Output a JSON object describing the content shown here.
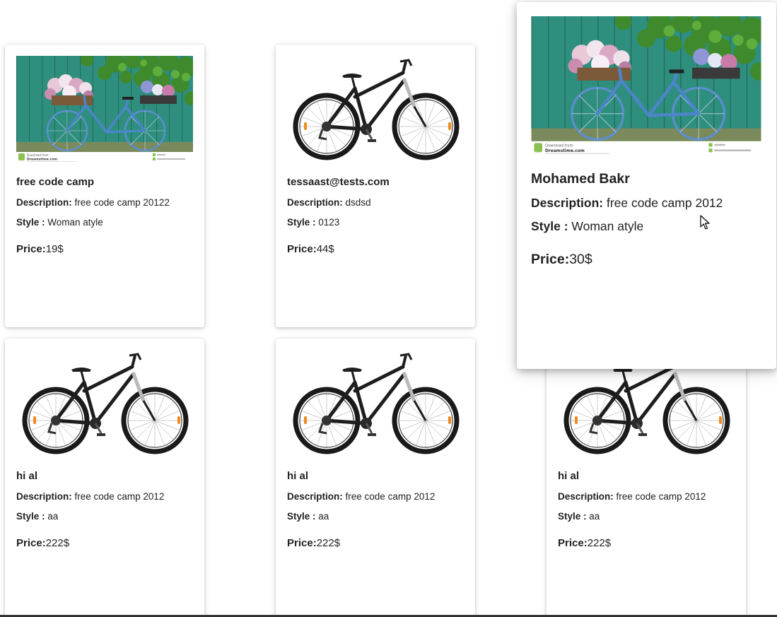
{
  "cards": [
    {
      "image": "flower-bike-photo",
      "title": "free code camp",
      "description_label": "Description:",
      "description": "free code camp 20122",
      "style_label": "Style :",
      "style": "Woman atyle",
      "price_label": "Price:",
      "price": "19$"
    },
    {
      "image": "black-bike-photo",
      "title": "tessaast@tests.com",
      "description_label": "Description:",
      "description": "dsdsd",
      "style_label": "Style :",
      "style": "0123",
      "price_label": "Price:",
      "price": "44$"
    },
    {
      "image": "flower-bike-photo",
      "title": "Mohamed Bakr",
      "description_label": "Description:",
      "description": "free code camp 2012",
      "style_label": "Style :",
      "style": "Woman atyle",
      "price_label": "Price:",
      "price": "30$"
    },
    {
      "image": "black-bike-photo",
      "title": "hi al",
      "description_label": "Description:",
      "description": "free code camp 2012",
      "style_label": "Style :",
      "style": "aa",
      "price_label": "Price:",
      "price": "222$"
    },
    {
      "image": "black-bike-photo",
      "title": "hi al",
      "description_label": "Description:",
      "description": "free code camp 2012",
      "style_label": "Style :",
      "style": "aa",
      "price_label": "Price:",
      "price": "222$"
    },
    {
      "image": "black-bike-photo",
      "title": "hi al",
      "description_label": "Description:",
      "description": "free code camp 2012",
      "style_label": "Style :",
      "style": "aa",
      "price_label": "Price:",
      "price": "222$"
    }
  ],
  "watermark": {
    "line1": "Download from",
    "line2": "Dreamstime.com"
  },
  "colors": {
    "card_bg": "#ffffff",
    "text": "#222222",
    "door_green": "#2f8f7e",
    "bike_blue": "#4a86c8",
    "bike_black": "#1a1a1a"
  }
}
